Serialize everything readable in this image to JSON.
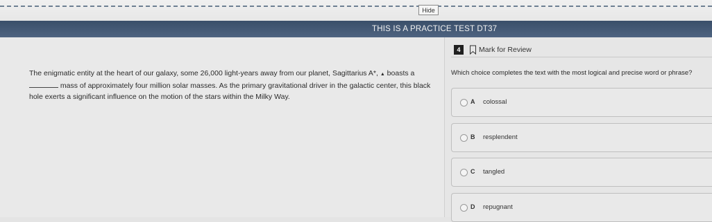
{
  "toolbar": {
    "hide_label": "Hide"
  },
  "banner": {
    "text": "THIS IS A PRACTICE TEST DT37"
  },
  "passage": {
    "part1": "The enigmatic entity at the heart of our galaxy, some 26,000 light-years away from our planet, Sagittarius A*, ",
    "caret": "▲",
    "part2": " boasts a ",
    "part3": " mass of approximately four million solar masses. As the primary gravitational driver in the galactic center, this black hole exerts a significant influence on the motion of the stars within the Milky Way."
  },
  "question": {
    "number": "4",
    "mark_label": "Mark for Review",
    "bookmark_icon": "bookmark-icon",
    "prompt": "Which choice completes the text with the most logical and precise word or phrase?",
    "options": [
      {
        "letter": "A",
        "text": "colossal"
      },
      {
        "letter": "B",
        "text": "resplendent"
      },
      {
        "letter": "C",
        "text": "tangled"
      },
      {
        "letter": "D",
        "text": "repugnant"
      }
    ]
  },
  "colors": {
    "banner_bg": "#4a5e7a",
    "dash_line": "#6d7f92"
  }
}
